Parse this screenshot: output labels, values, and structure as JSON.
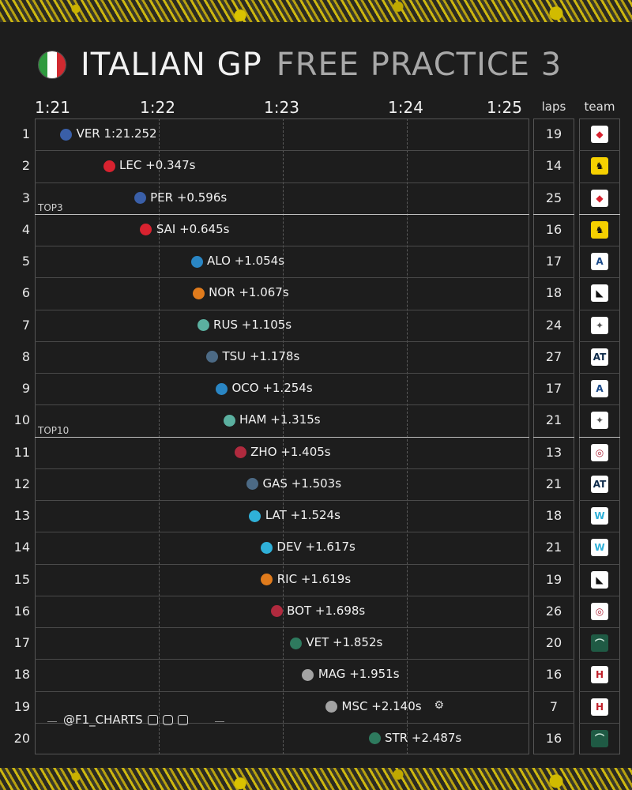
{
  "header": {
    "title_main": "ITALIAN GP",
    "title_sub": "FREE PRACTICE 3",
    "flag_colors": [
      "#2f9a3f",
      "#ffffff",
      "#d02a30"
    ]
  },
  "columns": {
    "laps": "laps",
    "team": "team"
  },
  "credit": {
    "handle": "@F1_CHARTS"
  },
  "colors": {
    "background": "#1d1d1d",
    "redbull": "#3a5fa8",
    "ferrari": "#d8222f",
    "alpine": "#2a86c4",
    "mclaren": "#e07b1c",
    "mercedes": "#5bb0a0",
    "alphatauri": "#4c6a85",
    "alfaromeo": "#b02a3e",
    "williams": "#2fb0d8",
    "astonmartin": "#2e7a5e",
    "haas": "#a3a3a3"
  },
  "chart_data": {
    "type": "scatter",
    "title": "ITALIAN GP FREE PRACTICE 3",
    "xlabel": "",
    "ylabel": "",
    "xlim": [
      "1:21",
      "1:25"
    ],
    "x_ticks": [
      "1:21",
      "1:22",
      "1:23",
      "1:24",
      "1:25"
    ],
    "x_tick_values_s": [
      81,
      82,
      83,
      84,
      85
    ],
    "grid": true,
    "tiers": [
      {
        "label": "TOP3",
        "after_position": 3
      },
      {
        "label": "TOP10",
        "after_position": 10
      }
    ],
    "drivers": [
      {
        "pos": 1,
        "code": "VER",
        "gap": "1:21.252",
        "time_s": 81.252,
        "laps": 19,
        "team": "redbull",
        "team_icon": "red-bull-logo-icon"
      },
      {
        "pos": 2,
        "code": "LEC",
        "gap": "+0.347s",
        "time_s": 81.599,
        "laps": 14,
        "team": "ferrari",
        "team_icon": "ferrari-logo-icon"
      },
      {
        "pos": 3,
        "code": "PER",
        "gap": "+0.596s",
        "time_s": 81.848,
        "laps": 25,
        "team": "redbull",
        "team_icon": "red-bull-logo-icon"
      },
      {
        "pos": 4,
        "code": "SAI",
        "gap": "+0.645s",
        "time_s": 81.897,
        "laps": 16,
        "team": "ferrari",
        "team_icon": "ferrari-logo-icon"
      },
      {
        "pos": 5,
        "code": "ALO",
        "gap": "+1.054s",
        "time_s": 82.306,
        "laps": 17,
        "team": "alpine",
        "team_icon": "alpine-logo-icon"
      },
      {
        "pos": 6,
        "code": "NOR",
        "gap": "+1.067s",
        "time_s": 82.319,
        "laps": 18,
        "team": "mclaren",
        "team_icon": "mclaren-logo-icon"
      },
      {
        "pos": 7,
        "code": "RUS",
        "gap": "+1.105s",
        "time_s": 82.357,
        "laps": 24,
        "team": "mercedes",
        "team_icon": "mercedes-logo-icon"
      },
      {
        "pos": 8,
        "code": "TSU",
        "gap": "+1.178s",
        "time_s": 82.43,
        "laps": 27,
        "team": "alphatauri",
        "team_icon": "alphatauri-logo-icon"
      },
      {
        "pos": 9,
        "code": "OCO",
        "gap": "+1.254s",
        "time_s": 82.506,
        "laps": 17,
        "team": "alpine",
        "team_icon": "alpine-logo-icon"
      },
      {
        "pos": 10,
        "code": "HAM",
        "gap": "+1.315s",
        "time_s": 82.567,
        "laps": 21,
        "team": "mercedes",
        "team_icon": "mercedes-logo-icon"
      },
      {
        "pos": 11,
        "code": "ZHO",
        "gap": "+1.405s",
        "time_s": 82.657,
        "laps": 13,
        "team": "alfaromeo",
        "team_icon": "alfa-romeo-logo-icon"
      },
      {
        "pos": 12,
        "code": "GAS",
        "gap": "+1.503s",
        "time_s": 82.755,
        "laps": 21,
        "team": "alphatauri",
        "team_icon": "alphatauri-logo-icon"
      },
      {
        "pos": 13,
        "code": "LAT",
        "gap": "+1.524s",
        "time_s": 82.776,
        "laps": 18,
        "team": "williams",
        "team_icon": "williams-logo-icon"
      },
      {
        "pos": 14,
        "code": "DEV",
        "gap": "+1.617s",
        "time_s": 82.869,
        "laps": 21,
        "team": "williams",
        "team_icon": "williams-logo-icon"
      },
      {
        "pos": 15,
        "code": "RIC",
        "gap": "+1.619s",
        "time_s": 82.871,
        "laps": 19,
        "team": "mclaren",
        "team_icon": "mclaren-logo-icon"
      },
      {
        "pos": 16,
        "code": "BOT",
        "gap": "+1.698s",
        "time_s": 82.95,
        "laps": 26,
        "team": "alfaromeo",
        "team_icon": "alfa-romeo-logo-icon"
      },
      {
        "pos": 17,
        "code": "VET",
        "gap": "+1.852s",
        "time_s": 83.104,
        "laps": 20,
        "team": "astonmartin",
        "team_icon": "aston-martin-logo-icon"
      },
      {
        "pos": 18,
        "code": "MAG",
        "gap": "+1.951s",
        "time_s": 83.203,
        "laps": 16,
        "team": "haas",
        "team_icon": "haas-logo-icon"
      },
      {
        "pos": 19,
        "code": "MSC",
        "gap": "+2.140s",
        "time_s": 83.392,
        "laps": 7,
        "team": "haas",
        "team_icon": "haas-logo-icon",
        "note_icon": "engine-icon"
      },
      {
        "pos": 20,
        "code": "STR",
        "gap": "+2.487s",
        "time_s": 83.739,
        "laps": 16,
        "team": "astonmartin",
        "team_icon": "aston-martin-logo-icon"
      }
    ]
  }
}
